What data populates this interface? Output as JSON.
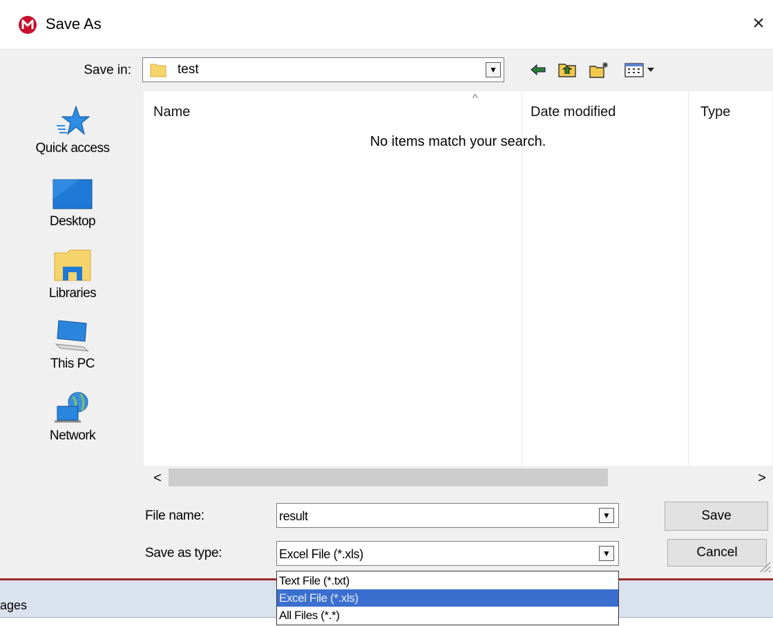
{
  "dialog": {
    "title": "Save As",
    "close_symbol": "×"
  },
  "save_in": {
    "label": "Save in:",
    "value": "test"
  },
  "toolbar": {
    "icons": [
      "back-arrow-icon",
      "up-folder-icon",
      "new-folder-icon",
      "view-menu-icon"
    ]
  },
  "places": [
    {
      "label": "Quick access",
      "icon": "quick-access-star-icon"
    },
    {
      "label": "Desktop",
      "icon": "desktop-icon"
    },
    {
      "label": "Libraries",
      "icon": "libraries-icon"
    },
    {
      "label": "This PC",
      "icon": "this-pc-icon"
    },
    {
      "label": "Network",
      "icon": "network-icon"
    }
  ],
  "file_list": {
    "columns": [
      "Name",
      "Date modified",
      "Type"
    ],
    "sort_indicator": "^",
    "empty_message": "No items match your search."
  },
  "scrollbar": {
    "left_symbol": "<",
    "right_symbol": ">"
  },
  "file_name": {
    "label": "File name:",
    "value": "result"
  },
  "save_as_type": {
    "label": "Save as type:",
    "value": "Excel File (*.xls)",
    "options": [
      "Text File (*.txt)",
      "Excel File (*.xls)",
      "All Files (*.*)"
    ],
    "selected_index": 1
  },
  "buttons": {
    "save": "Save",
    "cancel": "Cancel"
  },
  "background_window": {
    "tab_label": "ages"
  },
  "colors": {
    "accent_selection": "#3b6fcf",
    "app_icon_red": "#c8102e"
  }
}
